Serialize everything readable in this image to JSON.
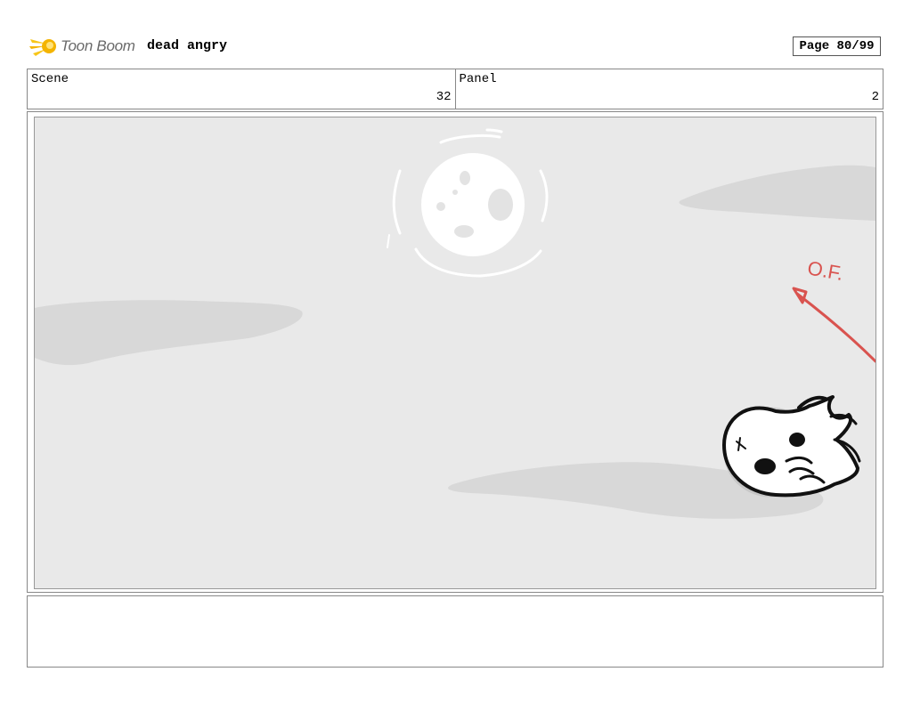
{
  "header": {
    "brand": "Toon Boom",
    "project_title": "dead angry",
    "page_label": "Page 80/99"
  },
  "info": {
    "scene_label": "Scene",
    "scene_value": "32",
    "panel_label": "Panel",
    "panel_value": "2"
  },
  "sketch": {
    "annotation": "O.F.",
    "ink_color": "#111111",
    "annotation_color": "#d9534f",
    "cloud_color": "#d6d6d6",
    "background_color": "#e9e9e9"
  },
  "notes": {
    "text": ""
  }
}
